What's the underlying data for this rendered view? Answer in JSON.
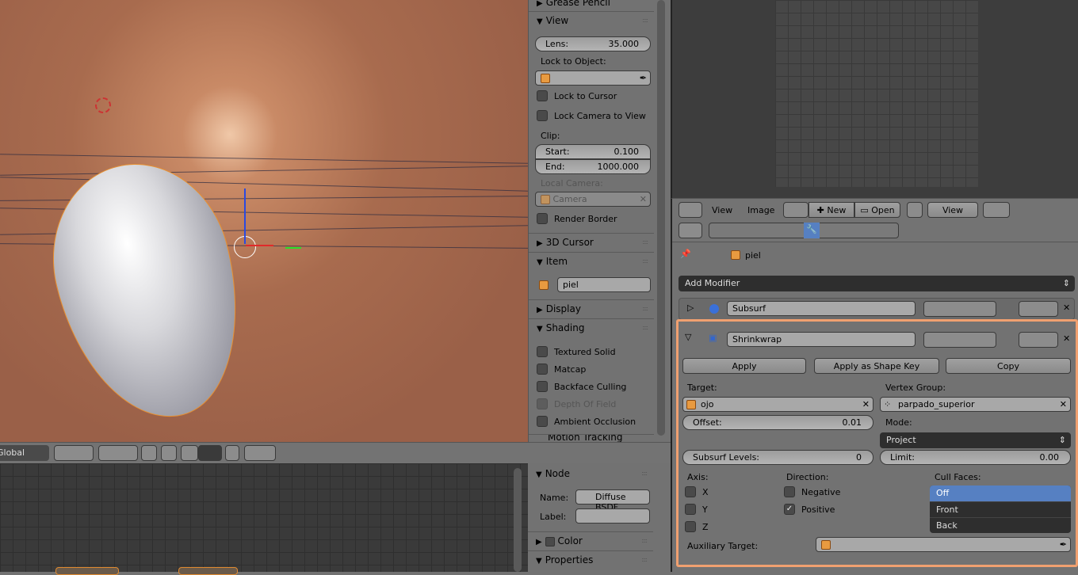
{
  "viewport": {
    "header": {
      "orientation": "Global"
    }
  },
  "view_panel": {
    "grease_pencil": "Grease Pencil",
    "view": "View",
    "lens_label": "Lens:",
    "lens_value": "35.000",
    "lock_to_object": "Lock to Object:",
    "lock_to_cursor": "Lock to Cursor",
    "lock_camera_to_view": "Lock Camera to View",
    "clip": "Clip:",
    "start_label": "Start:",
    "start_value": "0.100",
    "end_label": "End:",
    "end_value": "1000.000",
    "local_camera": "Local Camera:",
    "camera": "Camera",
    "render_border": "Render Border",
    "cursor_3d": "3D Cursor",
    "item": "Item",
    "item_name": "piel",
    "display": "Display",
    "shading": "Shading",
    "textured_solid": "Textured Solid",
    "matcap": "Matcap",
    "backface_culling": "Backface Culling",
    "depth_of_field": "Depth Of Field",
    "ambient_occlusion": "Ambient Occlusion",
    "motion_tracking": "Motion Tracking"
  },
  "node_panel": {
    "node": "Node",
    "name_label": "Name:",
    "name_value": "Diffuse BSDF",
    "label_label": "Label:",
    "color": "Color",
    "properties": "Properties"
  },
  "image_header": {
    "view": "View",
    "image": "Image",
    "new": "New",
    "open": "Open",
    "view_mode": "View"
  },
  "properties": {
    "breadcrumb": "piel",
    "add_modifier": "Add Modifier",
    "modifiers": [
      {
        "name": "Subsurf"
      },
      {
        "name": "Shrinkwrap"
      }
    ],
    "apply": "Apply",
    "apply_shape_key": "Apply as Shape Key",
    "copy": "Copy",
    "target_label": "Target:",
    "target": "ojo",
    "vertex_group_label": "Vertex Group:",
    "vertex_group": "parpado_superior",
    "offset_label": "Offset:",
    "offset": "0.01",
    "mode_label": "Mode:",
    "mode": "Project",
    "subsurf_levels_label": "Subsurf Levels:",
    "subsurf_levels": "0",
    "limit_label": "Limit:",
    "limit": "0.00",
    "axis_label": "Axis:",
    "x": "X",
    "y": "Y",
    "z": "Z",
    "direction_label": "Direction:",
    "negative": "Negative",
    "positive": "Positive",
    "cull_faces_label": "Cull Faces:",
    "cull_options": [
      "Off",
      "Front",
      "Back"
    ],
    "auxiliary_target_label": "Auxiliary Target:"
  },
  "colors": {
    "highlight": "#f0a070",
    "selected": "#5680c2"
  }
}
